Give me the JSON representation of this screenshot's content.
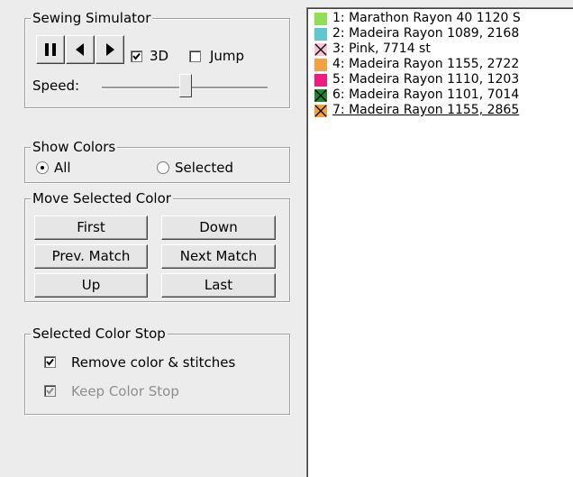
{
  "sewing_simulator": {
    "title": "Sewing Simulator",
    "buttons": {
      "pause": "pause-icon",
      "back": "step-back-icon",
      "forward": "step-forward-icon"
    },
    "checkbox_3d": {
      "label": "3D",
      "checked": true
    },
    "checkbox_jump": {
      "label": "Jump",
      "checked": false
    },
    "speed_label": "Speed:",
    "speed_value": 0.5
  },
  "show_colors": {
    "title": "Show Colors",
    "options": [
      {
        "label": "All",
        "selected": true
      },
      {
        "label": "Selected",
        "selected": false
      }
    ]
  },
  "move_selected_color": {
    "title": "Move Selected Color",
    "buttons": {
      "first": "First",
      "down": "Down",
      "prev_match": "Prev. Match",
      "next_match": "Next Match",
      "up": "Up",
      "last": "Last"
    }
  },
  "selected_color_stop": {
    "title": "Selected Color Stop",
    "remove": {
      "label": "Remove color & stitches",
      "checked": true
    },
    "keep": {
      "label": "Keep Color Stop",
      "checked": true,
      "disabled": true
    }
  },
  "color_list": [
    {
      "text": "1: Marathon Rayon 40 1120 S",
      "color": "#8fe055",
      "crossed": false,
      "selected": false
    },
    {
      "text": "2: Madeira Rayon 1089,  2168",
      "color": "#5fc7d2",
      "crossed": false,
      "selected": false
    },
    {
      "text": "3: Pink,  7714 st",
      "color": "#f7c3d8",
      "crossed": true,
      "selected": false
    },
    {
      "text": "4: Madeira Rayon 1155,  2722",
      "color": "#f5a040",
      "crossed": false,
      "selected": false
    },
    {
      "text": "5: Madeira Rayon 1110,  1203",
      "color": "#f01a80",
      "crossed": false,
      "selected": false
    },
    {
      "text": "6: Madeira Rayon 1101,  7014",
      "color": "#1c8a2a",
      "crossed": true,
      "selected": false
    },
    {
      "text": "7: Madeira Rayon 1155,  2865",
      "color": "#f5a040",
      "crossed": true,
      "selected": true
    }
  ]
}
